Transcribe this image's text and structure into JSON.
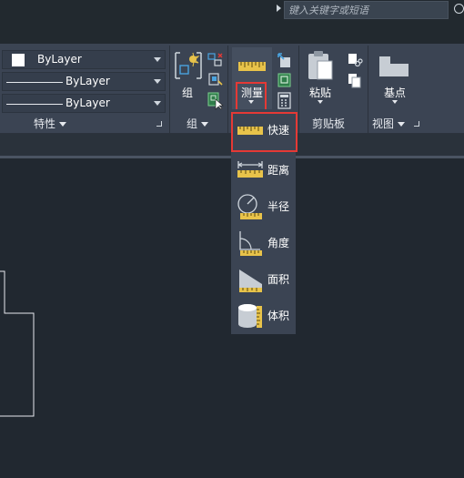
{
  "search": {
    "placeholder": "键入关键字或短语"
  },
  "properties_panel": {
    "color_value": "ByLayer",
    "linetype_value": "ByLayer",
    "lineweight_value": "ByLayer",
    "title": "特性"
  },
  "group_panel": {
    "group_label": "组",
    "title": "组"
  },
  "measure_tool": {
    "label": "测量"
  },
  "clipboard_panel": {
    "paste_label": "粘贴",
    "title": "剪贴板"
  },
  "view_panel": {
    "base_label": "基点",
    "title": "视图"
  },
  "measure_menu": {
    "items": [
      {
        "label": "快速",
        "icon": "quick-measure-icon",
        "highlighted": true
      },
      {
        "label": "距离",
        "icon": "distance-icon"
      },
      {
        "label": "半径",
        "icon": "radius-icon"
      },
      {
        "label": "角度",
        "icon": "angle-icon"
      },
      {
        "label": "面积",
        "icon": "area-icon"
      },
      {
        "label": "体积",
        "icon": "volume-icon"
      }
    ]
  },
  "colors": {
    "highlight": "#e53935",
    "ruler": "#e8c34a",
    "accent_blue": "#4aa3df"
  }
}
